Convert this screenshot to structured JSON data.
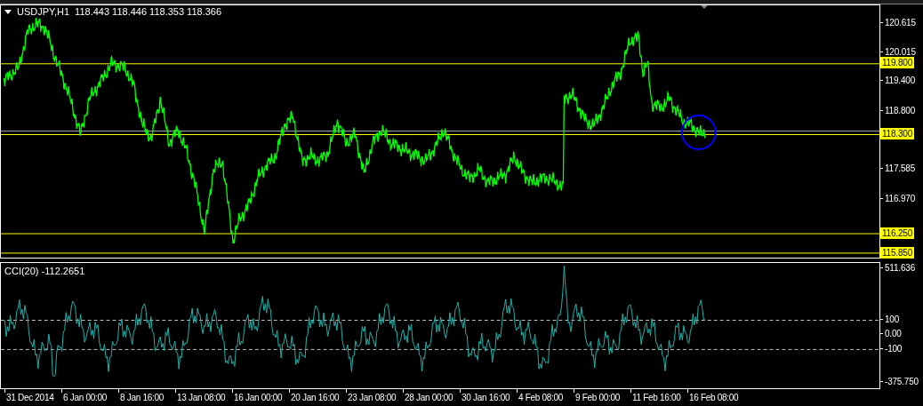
{
  "header": {
    "symbol": "USDJPY,H1",
    "ohlc": "118.443 118.446 118.353 118.366"
  },
  "price_axis": [
    {
      "text": "120.615",
      "kind": "tick"
    },
    {
      "text": "120.015",
      "kind": "tick"
    },
    {
      "text": "119.800",
      "kind": "level"
    },
    {
      "text": "119.400",
      "kind": "tick"
    },
    {
      "text": "118.800",
      "kind": "tick"
    },
    {
      "text": "118.300",
      "kind": "level"
    },
    {
      "text": "117.585",
      "kind": "tick"
    },
    {
      "text": "116.970",
      "kind": "tick"
    },
    {
      "text": "116.250",
      "kind": "level"
    },
    {
      "text": "115.850",
      "kind": "level"
    }
  ],
  "indicator": {
    "title": "CCI(20) -112.2651",
    "axis": [
      {
        "text": "511.636",
        "kind": "tick"
      },
      {
        "text": "100",
        "kind": "level"
      },
      {
        "text": "0.00",
        "kind": "tick"
      },
      {
        "text": "-100",
        "kind": "level"
      },
      {
        "text": "-375.750",
        "kind": "tick"
      }
    ]
  },
  "time_axis": [
    "31 Dec 2014",
    "6 Jan 00:00",
    "8 Jan 16:00",
    "13 Jan 08:00",
    "16 Jan 00:00",
    "20 Jan 16:00",
    "23 Jan 08:00",
    "28 Jan 00:00",
    "30 Jan 16:00",
    "4 Feb 08:00",
    "9 Feb 00:00",
    "11 Feb 16:00",
    "16 Feb 08:00"
  ]
}
